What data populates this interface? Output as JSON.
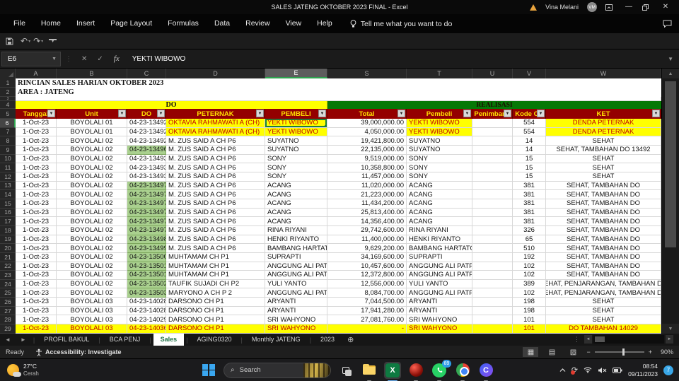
{
  "window": {
    "title": "SALES JATENG OKTOBER 2023 FINAL  -  Excel",
    "user": "Vina Melani",
    "user_initials": "VM"
  },
  "menu": {
    "tabs": [
      "File",
      "Home",
      "Insert",
      "Page Layout",
      "Formulas",
      "Data",
      "Review",
      "View",
      "Help"
    ],
    "tell_me": "Tell me what you want to do"
  },
  "formula_bar": {
    "name_box": "E6",
    "formula": "YEKTI WIBOWO"
  },
  "grid": {
    "columns": [
      "A",
      "B",
      "C",
      "D",
      "E",
      "S",
      "T",
      "U",
      "V",
      "W"
    ],
    "selected_column": "E",
    "selected_cell": {
      "row": 6,
      "col": "E"
    },
    "title_rows": [
      "RINCIAN SALES HARIAN OKTOBER 2023",
      "AREA : JATENG"
    ],
    "bands": {
      "do": "DO",
      "realisasi": "REALISASI"
    },
    "header_labels": [
      "Tanggal",
      "Unit",
      "DO",
      "PETERNAK",
      "PEMBELI",
      "Total",
      "Pembeli",
      "Penimbang",
      "Kode CP",
      "KET"
    ],
    "rows": [
      {
        "n": 6,
        "c": [
          "1-Oct-23",
          "BOYOLALI 01",
          "04-23-13492",
          "OKTAVIA RAHMAWATI A (CH)",
          "YEKTI WIBOWO",
          "39,000,000.00",
          "YEKTI WIBOWO",
          "",
          "554",
          "DENDA PETERNAK"
        ],
        "y": [
          3,
          4,
          6,
          9
        ]
      },
      {
        "n": 7,
        "c": [
          "1-Oct-23",
          "BOYOLALI 01",
          "04-23-13492",
          "OKTAVIA RAHMAWATI A (CH)",
          "YEKTI WIBOWO",
          "4,050,000.00",
          "YEKTI WIBOWO",
          "",
          "554",
          "DENDA PETERNAK"
        ],
        "y": [
          3,
          4,
          6,
          9
        ]
      },
      {
        "n": 8,
        "c": [
          "1-Oct-23",
          "BOYOLALI 02",
          "04-23-13492",
          "M. ZUS SAID A CH P6",
          "SUYATNO",
          "19,421,800.00",
          "SUYATNO",
          "",
          "14",
          "SEHAT"
        ]
      },
      {
        "n": 9,
        "c": [
          "1-Oct-23",
          "BOYOLALI 02",
          "04-23-13496",
          "M. ZUS SAID A CH P6",
          "SUYATNO",
          "22,135,000.00",
          "SUYATNO",
          "",
          "14",
          "SEHAT, TAMBAHAN DO 13492"
        ],
        "g": true
      },
      {
        "n": 10,
        "c": [
          "1-Oct-23",
          "BOYOLALI 02",
          "04-23-13493",
          "M. ZUS SAID A CH P6",
          "SONY",
          "9,519,000.00",
          "SONY",
          "",
          "15",
          "SEHAT"
        ]
      },
      {
        "n": 11,
        "c": [
          "1-Oct-23",
          "BOYOLALI 02",
          "04-23-13493",
          "M. ZUS SAID A CH P6",
          "SONY",
          "10,358,800.00",
          "SONY",
          "",
          "15",
          "SEHAT"
        ]
      },
      {
        "n": 12,
        "c": [
          "1-Oct-23",
          "BOYOLALI 02",
          "04-23-13493",
          "M. ZUS SAID A CH P6",
          "SONY",
          "11,457,000.00",
          "SONY",
          "",
          "15",
          "SEHAT"
        ]
      },
      {
        "n": 13,
        "c": [
          "1-Oct-23",
          "BOYOLALI 02",
          "04-23-13497",
          "M. ZUS SAID A CH P6",
          "ACANG",
          "11,020,000.00",
          "ACANG",
          "",
          "381",
          "SEHAT, TAMBAHAN DO"
        ],
        "g": true
      },
      {
        "n": 14,
        "c": [
          "1-Oct-23",
          "BOYOLALI 02",
          "04-23-13497",
          "M. ZUS SAID A CH P6",
          "ACANG",
          "21,223,000.00",
          "ACANG",
          "",
          "381",
          "SEHAT, TAMBAHAN DO"
        ],
        "g": true
      },
      {
        "n": 15,
        "c": [
          "1-Oct-23",
          "BOYOLALI 02",
          "04-23-13497",
          "M. ZUS SAID A CH P6",
          "ACANG",
          "11,434,200.00",
          "ACANG",
          "",
          "381",
          "SEHAT, TAMBAHAN DO"
        ],
        "g": true
      },
      {
        "n": 16,
        "c": [
          "1-Oct-23",
          "BOYOLALI 02",
          "04-23-13497",
          "M. ZUS SAID A CH P6",
          "ACANG",
          "25,813,400.00",
          "ACANG",
          "",
          "381",
          "SEHAT, TAMBAHAN DO"
        ],
        "g": true
      },
      {
        "n": 17,
        "c": [
          "1-Oct-23",
          "BOYOLALI 02",
          "04-23-13497",
          "M. ZUS SAID A CH P6",
          "ACANG",
          "14,356,400.00",
          "ACANG",
          "",
          "381",
          "SEHAT, TAMBAHAN DO"
        ],
        "g": true
      },
      {
        "n": 18,
        "c": [
          "1-Oct-23",
          "BOYOLALI 02",
          "04-23-13497",
          "M. ZUS SAID A CH P6",
          "RINA RIYANI",
          "29,742,600.00",
          "RINA RIYANI",
          "",
          "326",
          "SEHAT, TAMBAHAN DO"
        ],
        "g": true
      },
      {
        "n": 19,
        "c": [
          "1-Oct-23",
          "BOYOLALI 02",
          "04-23-13498",
          "M. ZUS SAID A CH P6",
          "HENKI RIYANTO",
          "11,400,000.00",
          "HENKI RIYANTO",
          "",
          "65",
          "SEHAT, TAMBAHAN DO"
        ],
        "g": true
      },
      {
        "n": 20,
        "c": [
          "1-Oct-23",
          "BOYOLALI 02",
          "04-23-13499",
          "M. ZUS SAID A CH P6",
          "BAMBANG HARTATO",
          "9,629,200.00",
          "BAMBANG HARTATO",
          "",
          "510",
          "SEHAT, TAMBAHAN DO"
        ],
        "g": true
      },
      {
        "n": 21,
        "c": [
          "1-Oct-23",
          "BOYOLALI 02",
          "04-23-13500",
          "MUHTAMAM CH P1",
          "SUPRAPTI",
          "34,169,600.00",
          "SUPRAPTI",
          "",
          "192",
          "SEHAT, TAMBAHAN DO"
        ],
        "g": true
      },
      {
        "n": 22,
        "c": [
          "1-Oct-23",
          "BOYOLALI 02",
          "04-23-13501",
          "MUHTAMAM CH P1",
          "ANGGUNG ALI PATPURI",
          "10,457,600.00",
          "ANGGUNG ALI PATPURI",
          "",
          "102",
          "SEHAT, TAMBAHAN DO"
        ],
        "g": true
      },
      {
        "n": 23,
        "c": [
          "1-Oct-23",
          "BOYOLALI 02",
          "04-23-13501",
          "MUHTAMAM CH P1",
          "ANGGUNG ALI PATPURI",
          "12,372,800.00",
          "ANGGUNG ALI PATPURI",
          "",
          "102",
          "SEHAT, TAMBAHAN DO"
        ],
        "g": true
      },
      {
        "n": 24,
        "c": [
          "1-Oct-23",
          "BOYOLALI 02",
          "04-23-13502",
          "TAUFIK SUJADI CH P2",
          "YULI YANTO",
          "12,556,000.00",
          "YULI YANTO",
          "",
          "389",
          "SEHAT, PENJARANGAN, TAMBAHAN DO"
        ],
        "g": true
      },
      {
        "n": 25,
        "c": [
          "1-Oct-23",
          "BOYOLALI 02",
          "04-23-13503",
          "MARYONO A CH P 2",
          "ANGGUNG ALI PATPURI",
          "8,084,700.00",
          "ANGGUNG ALI PATPURI",
          "",
          "102",
          "SEHAT, PENJARANGAN, TAMBAHAN DO"
        ],
        "g": true
      },
      {
        "n": 26,
        "c": [
          "1-Oct-23",
          "BOYOLALI 03",
          "04-23-14028",
          "DARSONO CH P1",
          "ARYANTI",
          "7,044,500.00",
          "ARYANTI",
          "",
          "198",
          "SEHAT"
        ]
      },
      {
        "n": 27,
        "c": [
          "1-Oct-23",
          "BOYOLALI 03",
          "04-23-14028",
          "DARSONO CH P1",
          "ARYANTI",
          "17,941,280.00",
          "ARYANTI",
          "",
          "198",
          "SEHAT"
        ]
      },
      {
        "n": 28,
        "c": [
          "1-Oct-23",
          "BOYOLALI 03",
          "04-23-14029",
          "DARSONO CH P1",
          "SRI WAHYONO",
          "27,081,760.00",
          "SRI WAHYONO",
          "",
          "101",
          "SEHAT"
        ]
      },
      {
        "n": 29,
        "c": [
          "1-Oct-23",
          "BOYOLALI 03",
          "04-23-14036",
          "DARSONO CH P1",
          "SRI WAHYONO",
          "-",
          "SRI WAHYONO",
          "",
          "101",
          "DO TAMBAHAN 14029"
        ],
        "ry": true
      }
    ]
  },
  "sheet_bar": {
    "tabs": [
      {
        "label": "PROFIL BAKUL",
        "active": false
      },
      {
        "label": "BCA PENJ",
        "active": false
      },
      {
        "label": "Sales",
        "active": true
      },
      {
        "label": "AGING0320",
        "active": false
      },
      {
        "label": "Monthly JATENG",
        "active": false
      },
      {
        "label": "2023",
        "active": false
      }
    ]
  },
  "status_bar": {
    "ready": "Ready",
    "accessibility": "Accessibility: Investigate",
    "zoom": "90%"
  },
  "taskbar": {
    "weather_temp": "27°C",
    "weather_desc": "Cerah",
    "search_placeholder": "Search",
    "whatsapp_badge": "89",
    "time": "08:54",
    "date": "09/11/2023",
    "notification_count": "7"
  },
  "colors": {
    "header_bg": "#940000",
    "header_text": "#FFE100",
    "band_do_bg": "#FFFF00",
    "band_realisasi_bg": "#067806",
    "cell_green": "#A9D08E",
    "cell_yellow": "#FFFF00",
    "highlight_text": "#C00000",
    "accent_green": "#2EA44F",
    "active_tab_text": "#1E7145"
  }
}
